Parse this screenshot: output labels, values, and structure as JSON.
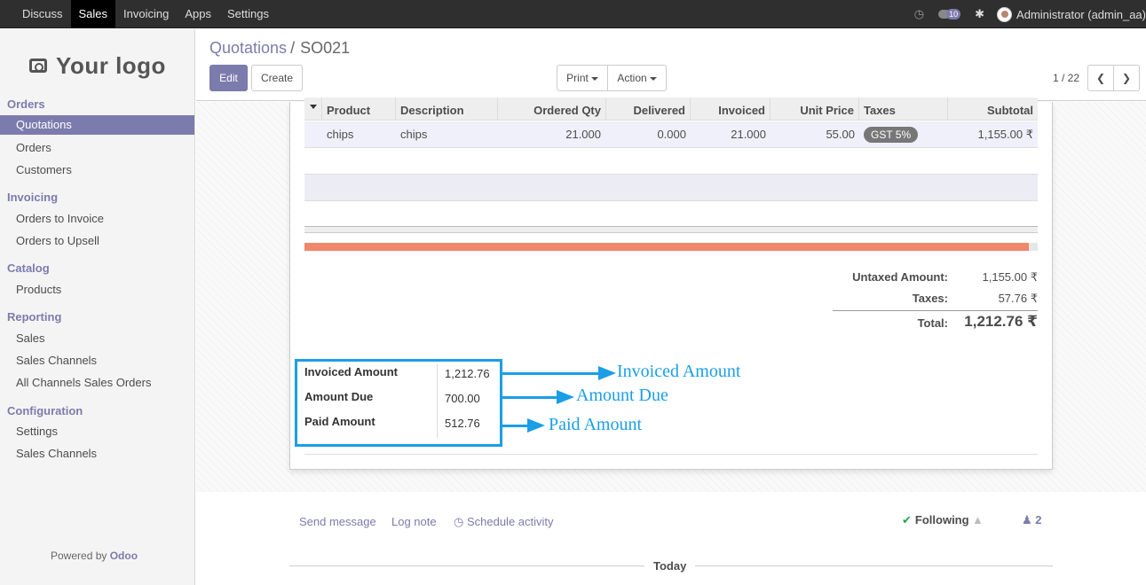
{
  "topbar": {
    "menu": [
      "Discuss",
      "Sales",
      "Invoicing",
      "Apps",
      "Settings"
    ],
    "active": "Sales",
    "clock_icon": "clock-icon",
    "chat_badge": "10",
    "bug_icon": "bug-icon",
    "user": "Administrator (admin_aa)"
  },
  "sidebar": {
    "logo_text": "Your logo",
    "sections": [
      {
        "title": "Orders",
        "items": [
          "Quotations",
          "Orders",
          "Customers"
        ]
      },
      {
        "title": "Invoicing",
        "items": [
          "Orders to Invoice",
          "Orders to Upsell"
        ]
      },
      {
        "title": "Catalog",
        "items": [
          "Products"
        ]
      },
      {
        "title": "Reporting",
        "items": [
          "Sales",
          "Sales Channels",
          "All Channels Sales Orders"
        ]
      },
      {
        "title": "Configuration",
        "items": [
          "Settings",
          "Sales Channels"
        ]
      }
    ],
    "active_item": "Quotations",
    "powered_prefix": "Powered by",
    "powered_brand": "Odoo"
  },
  "control_panel": {
    "breadcrumb_parent": "Quotations",
    "breadcrumb_sep": "/",
    "breadcrumb_current": "SO021",
    "edit_label": "Edit",
    "create_label": "Create",
    "print_label": "Print",
    "action_label": "Action",
    "pager": "1 / 22",
    "prev_icon": "chevron-left-icon",
    "next_icon": "chevron-right-icon"
  },
  "order_lines": {
    "headers": [
      "Product",
      "Description",
      "Ordered Qty",
      "Delivered",
      "Invoiced",
      "Unit Price",
      "Taxes",
      "Subtotal"
    ],
    "rows": [
      {
        "product": "chips",
        "description": "chips",
        "ordered_qty": "21.000",
        "delivered": "0.000",
        "invoiced": "21.000",
        "unit_price": "55.00",
        "taxes": "GST 5%",
        "subtotal": "1,155.00 ₹"
      }
    ]
  },
  "totals": {
    "untaxed_label": "Untaxed Amount:",
    "untaxed_value": "1,155.00 ₹",
    "taxes_label": "Taxes:",
    "taxes_value": "57.76 ₹",
    "total_label": "Total:",
    "total_value": "1,212.76 ₹"
  },
  "payment_summary": {
    "invoiced_label": "Invoiced Amount",
    "invoiced_value": "1,212.76",
    "due_label": "Amount Due",
    "due_value": "700.00",
    "paid_label": "Paid Amount",
    "paid_value": "512.76"
  },
  "annotations": [
    "Invoiced Amount",
    "Amount Due",
    "Paid Amount"
  ],
  "annotation_color": "#1a9ee6",
  "chatter": {
    "send_message": "Send message",
    "log_note": "Log note",
    "schedule_activity": "Schedule activity",
    "following": "Following",
    "followers_count": "2",
    "today": "Today"
  },
  "colors": {
    "brand": "#7c7bad",
    "topbar": "#2f2f2f",
    "progress": "#f0866a"
  }
}
